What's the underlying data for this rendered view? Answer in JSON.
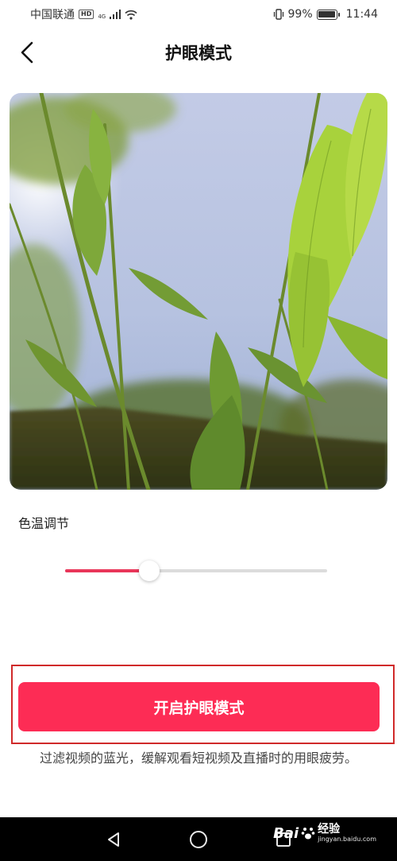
{
  "status_bar": {
    "carrier": "中国联通",
    "hd_badge": "HD",
    "network_type": "4G",
    "battery_percent": "99%",
    "battery_level": 0.99,
    "time": "11:44",
    "icons": [
      "signal-icon",
      "wifi-icon",
      "vibrate-icon",
      "battery-icon"
    ]
  },
  "header": {
    "title": "护眼模式",
    "back_icon": "chevron-left-icon"
  },
  "preview": {
    "image": "bamboo-leaves-sky-photo"
  },
  "color_temperature": {
    "label": "色温调节",
    "value": 0.32,
    "accent_color": "#e9365a"
  },
  "action": {
    "button_label": "开启护眼模式",
    "button_color": "#fd2c55",
    "description": "过滤视频的蓝光，缓解观看短视频及直播时的用眼疲劳。"
  },
  "nav_bar": {
    "icons": [
      "back-triangle-icon",
      "home-circle-icon",
      "recents-square-icon"
    ]
  },
  "watermark": {
    "logo": "Bai",
    "title": "经验",
    "url": "jingyan.baidu.com"
  }
}
